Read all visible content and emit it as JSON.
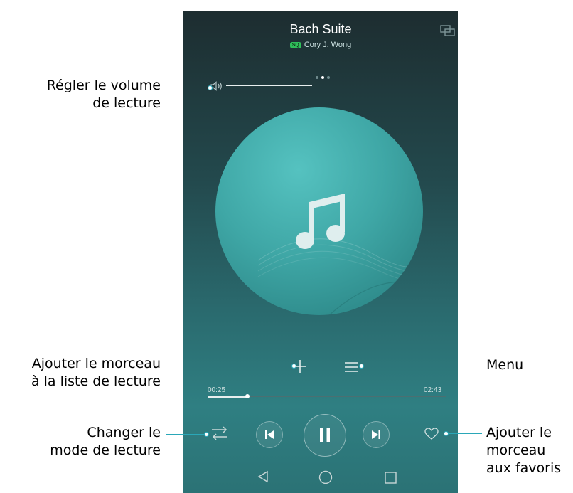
{
  "player": {
    "track_title": "Bach Suite",
    "quality_badge": "SQ",
    "artist": "Cory J. Wong",
    "page_indicator": {
      "count": 3,
      "active": 2
    },
    "volume_level": 0.39,
    "current_time": "00:25",
    "total_time": "02:43",
    "progress_level": 0.167,
    "icons": {
      "cast": "screen-cast-icon",
      "volume": "speaker-icon",
      "album_art": "music-note-icon",
      "add": "plus-icon",
      "menu": "hamburger-menu-icon",
      "play_mode": "repeat-shuffle-icon",
      "previous": "skip-previous-icon",
      "pause": "pause-icon",
      "next": "skip-next-icon",
      "favorite": "heart-icon"
    },
    "navigation": {
      "back": "triangle-back-icon",
      "home": "circle-home-icon",
      "recent": "square-recent-icon"
    }
  },
  "callouts": {
    "volume_line1": "Régler le volume",
    "volume_line2": "de lecture",
    "add_line1": "Ajouter le morceau",
    "add_line2": "à la liste de lecture",
    "mode_line1": "Changer le",
    "mode_line2": "mode de lecture",
    "menu": "Menu",
    "fav_line1": "Ajouter le",
    "fav_line2": "morceau",
    "fav_line3": "aux favoris"
  },
  "colors": {
    "accent_line": "#2aa7b8",
    "cover_teal": "#3fa7a6",
    "sq_badge": "#2fbf5a"
  }
}
